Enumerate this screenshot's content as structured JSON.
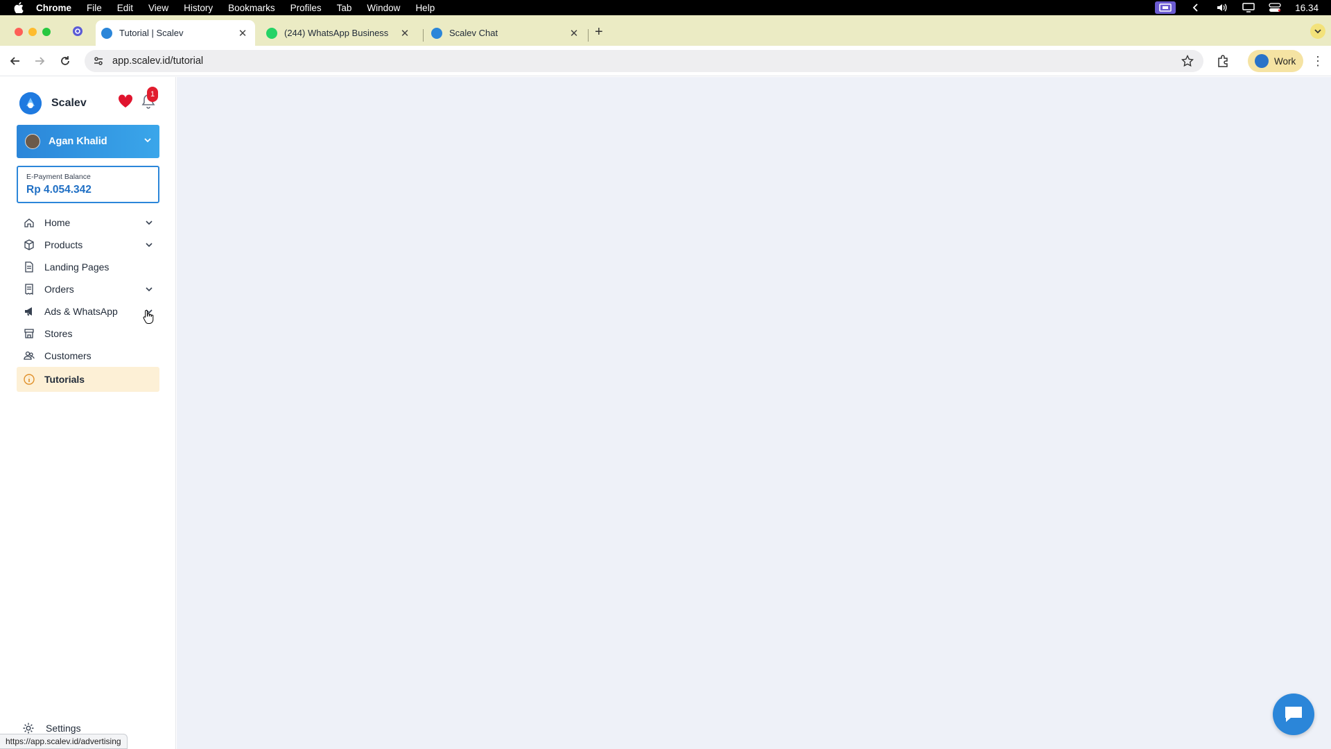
{
  "menubar": {
    "app": "Chrome",
    "items": [
      "File",
      "Edit",
      "View",
      "History",
      "Bookmarks",
      "Profiles",
      "Tab",
      "Window",
      "Help"
    ],
    "clock": "16.34"
  },
  "tabs": [
    {
      "title": "Tutorial | Scalev",
      "active": true
    },
    {
      "title": "(244) WhatsApp Business",
      "active": false
    },
    {
      "title": "Scalev Chat",
      "active": false
    }
  ],
  "toolbar": {
    "url": "app.scalev.id/tutorial",
    "profile_label": "Work"
  },
  "sidebar": {
    "brand": "Scalev",
    "notification_count": "1",
    "user_name": "Agan Khalid",
    "balance_label": "E-Payment Balance",
    "balance_value": "Rp 4.054.342",
    "items": [
      {
        "label": "Home",
        "icon": "home-icon",
        "has_chevron": true
      },
      {
        "label": "Products",
        "icon": "box-icon",
        "has_chevron": true
      },
      {
        "label": "Landing Pages",
        "icon": "document-icon",
        "has_chevron": false
      },
      {
        "label": "Orders",
        "icon": "receipt-icon",
        "has_chevron": true
      },
      {
        "label": "Ads & WhatsApp",
        "icon": "megaphone-icon",
        "has_chevron": true
      },
      {
        "label": "Stores",
        "icon": "store-icon",
        "has_chevron": false
      },
      {
        "label": "Customers",
        "icon": "users-icon",
        "has_chevron": false
      },
      {
        "label": "Tutorials",
        "icon": "info-icon",
        "has_chevron": false,
        "active": true
      }
    ],
    "settings_label": "Settings"
  },
  "status_bar": {
    "hover_url": "https://app.scalev.id/advertising"
  },
  "colors": {
    "accent": "#2b86d9",
    "active_item_bg": "#fdf0d6",
    "main_bg": "#eef1f8",
    "tabstrip_bg": "#ebebc4"
  }
}
